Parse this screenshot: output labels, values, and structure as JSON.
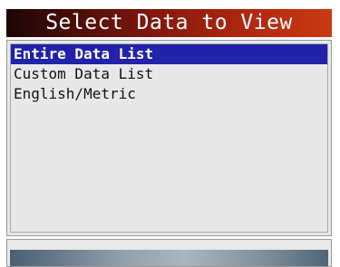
{
  "header": {
    "title": "Select Data to View"
  },
  "menu": {
    "items": [
      {
        "label": "Entire Data List",
        "selected": true
      },
      {
        "label": "Custom Data List",
        "selected": false
      },
      {
        "label": "English/Metric",
        "selected": false
      }
    ]
  },
  "colors": {
    "selection": "#2222aa",
    "title_gradient_start": "#1a0604",
    "title_gradient_end": "#c83a12",
    "panel_background": "#e8e8e8"
  }
}
